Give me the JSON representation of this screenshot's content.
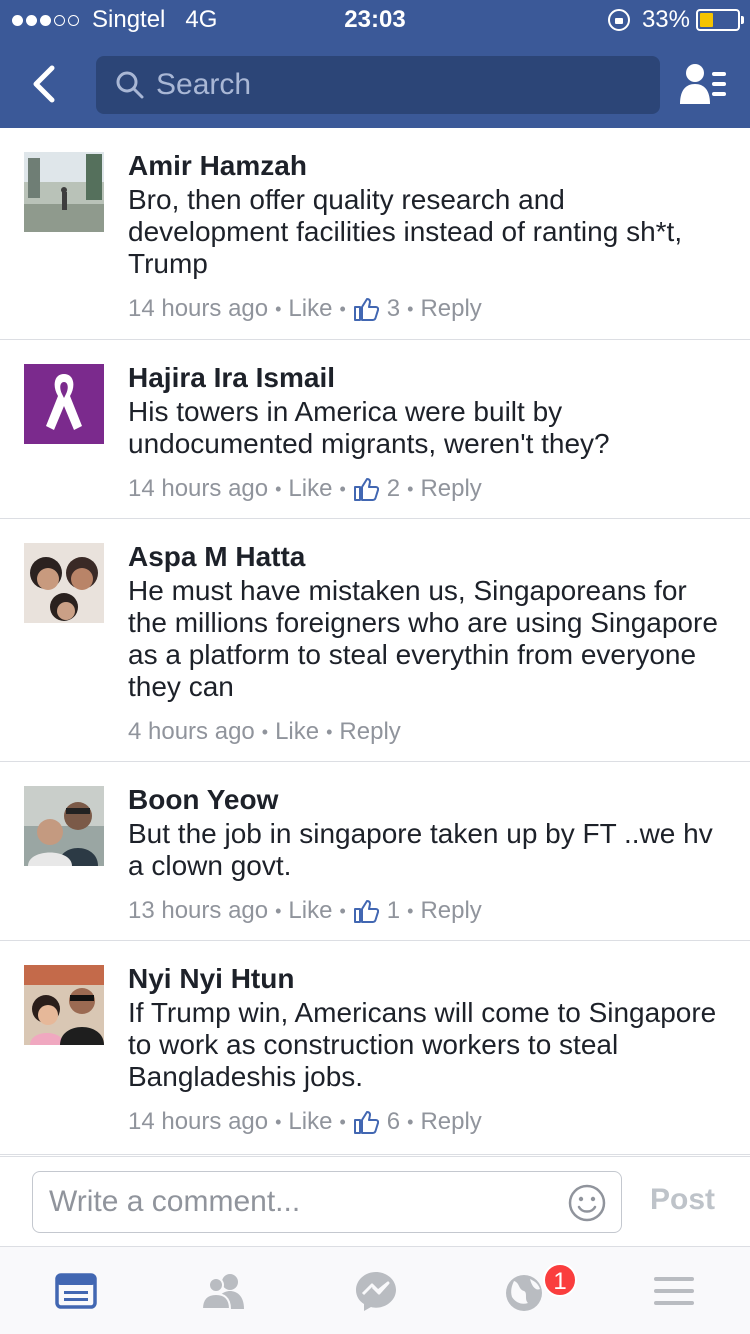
{
  "status_bar": {
    "signal_bars_filled": 3,
    "signal_bars_total": 5,
    "carrier": "Singtel",
    "network": "4G",
    "time": "23:03",
    "battery": "33%",
    "battery_level": 0.33
  },
  "nav": {
    "search_placeholder": "Search"
  },
  "colors": {
    "brand": "#3b5998",
    "search_bg": "#2c4577",
    "like_blue": "#4267b2",
    "meta_gray": "#90949c",
    "badge_red": "#fa3e3e",
    "battery_yellow": "#f5c400"
  },
  "comments": [
    {
      "name": "Amir Hamzah",
      "text": "Bro, then offer quality research and development facilities instead of ranting sh*t, Trump",
      "time": "14 hours ago",
      "like_label": "Like",
      "likes": "3",
      "reply_label": "Reply"
    },
    {
      "name": "Hajira Ira Ismail",
      "text": "His towers in America were built by undocumented migrants, weren't they?",
      "time": "14 hours ago",
      "like_label": "Like",
      "likes": "2",
      "reply_label": "Reply"
    },
    {
      "name": "Aspa M Hatta",
      "text": "He must have mistaken us, Singaporeans for the millions foreigners who are using Singapore as a platform to steal everythin from everyone they can",
      "time": "4 hours ago",
      "like_label": "Like",
      "likes": "",
      "reply_label": "Reply"
    },
    {
      "name": "Boon Yeow",
      "text": "But the job in singapore taken up by FT ..we hv a clown govt.",
      "time": "13 hours ago",
      "like_label": "Like",
      "likes": "1",
      "reply_label": "Reply"
    },
    {
      "name": "Nyi Nyi Htun",
      "text": "If Trump win, Americans will come to Singapore to work as construction workers to steal Bangladeshis jobs.",
      "time": "14 hours ago",
      "like_label": "Like",
      "likes": "6",
      "reply_label": "Reply"
    }
  ],
  "composer": {
    "placeholder": "Write a comment...",
    "post_label": "Post"
  },
  "tabbar": {
    "items": [
      "news-feed-icon",
      "friends-icon",
      "messenger-icon",
      "notifications-globe-icon",
      "menu-icon"
    ],
    "notification_count": "1"
  }
}
